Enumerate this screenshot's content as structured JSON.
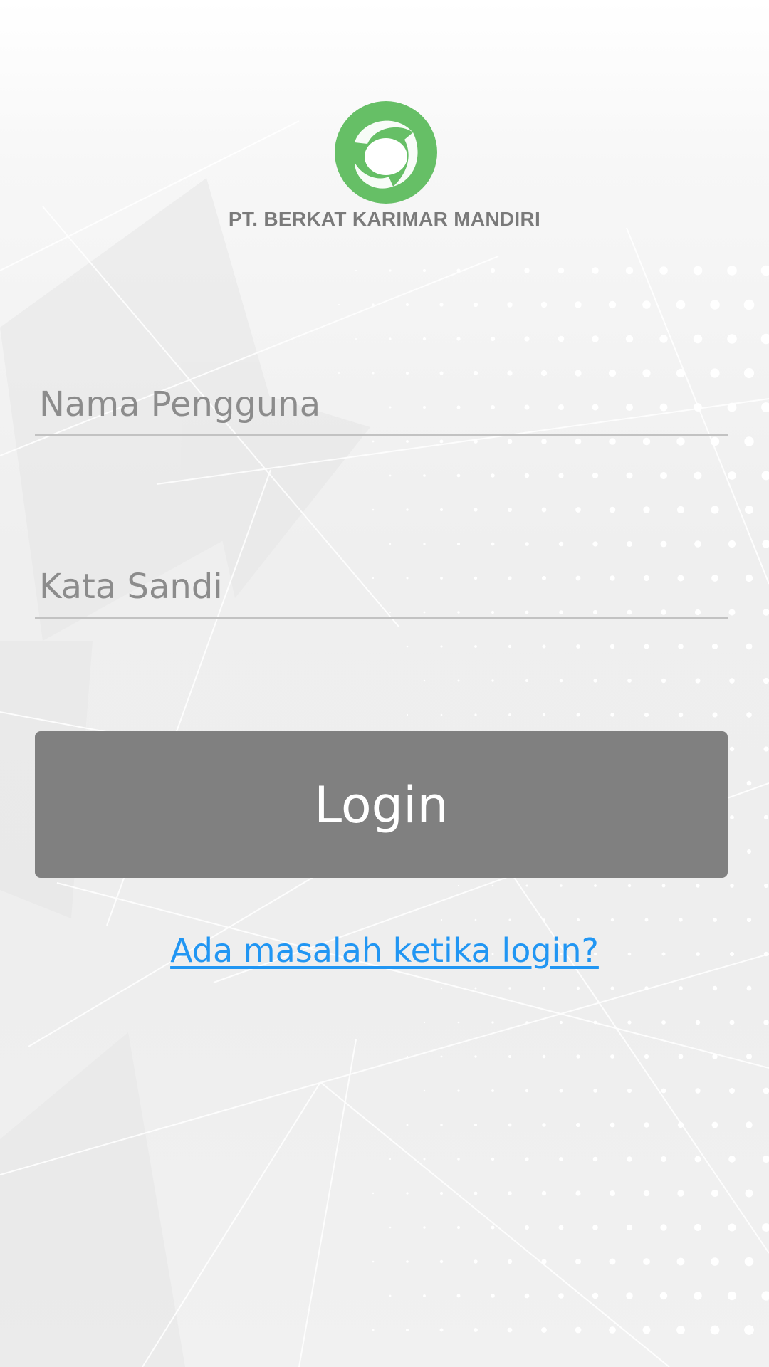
{
  "company": {
    "name": "PT. BERKAT KARIMAR MANDIRI",
    "logo_color": "#66bf66"
  },
  "form": {
    "username_placeholder": "Nama Pengguna",
    "password_placeholder": "Kata Sandi",
    "login_label": "Login",
    "help_link": "Ada masalah ketika login?"
  },
  "colors": {
    "button_bg": "#808080",
    "link": "#2196f3",
    "field_underline": "#c2c2c2"
  }
}
